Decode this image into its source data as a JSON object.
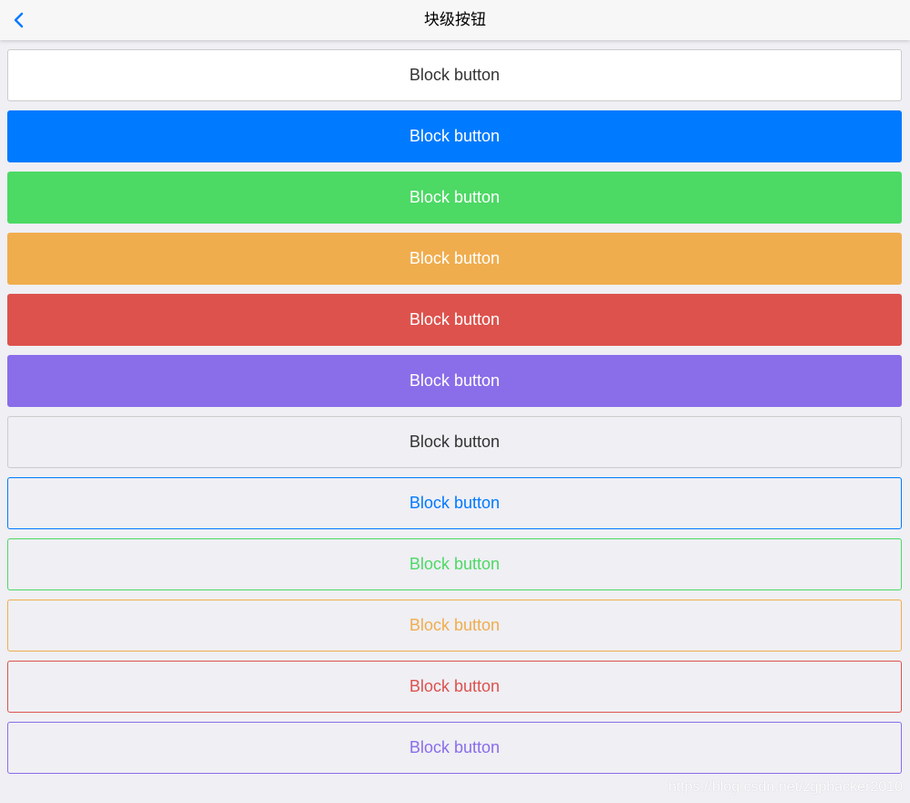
{
  "navbar": {
    "title": "块级按钮",
    "back_icon": "chevron-left-icon",
    "accent_color": "#007aff"
  },
  "buttons": [
    {
      "label": "Block button",
      "style": "default",
      "variant": "filled",
      "color": "#ffffff"
    },
    {
      "label": "Block button",
      "style": "primary",
      "variant": "filled",
      "color": "#007aff"
    },
    {
      "label": "Block button",
      "style": "positive",
      "variant": "filled",
      "color": "#4cd964"
    },
    {
      "label": "Block button",
      "style": "warning",
      "variant": "filled",
      "color": "#f0ad4e"
    },
    {
      "label": "Block button",
      "style": "danger",
      "variant": "filled",
      "color": "#dd524d"
    },
    {
      "label": "Block button",
      "style": "royal",
      "variant": "filled",
      "color": "#8a6de9"
    },
    {
      "label": "Block button",
      "style": "default",
      "variant": "outlined",
      "color": "#cccccc"
    },
    {
      "label": "Block button",
      "style": "primary",
      "variant": "outlined",
      "color": "#007aff"
    },
    {
      "label": "Block button",
      "style": "positive",
      "variant": "outlined",
      "color": "#4cd964"
    },
    {
      "label": "Block button",
      "style": "warning",
      "variant": "outlined",
      "color": "#f0ad4e"
    },
    {
      "label": "Block button",
      "style": "danger",
      "variant": "outlined",
      "color": "#dd524d"
    },
    {
      "label": "Block button",
      "style": "royal",
      "variant": "outlined",
      "color": "#8a6de9"
    }
  ],
  "watermark": "https://blog.csdn.net/zgphacker2010"
}
